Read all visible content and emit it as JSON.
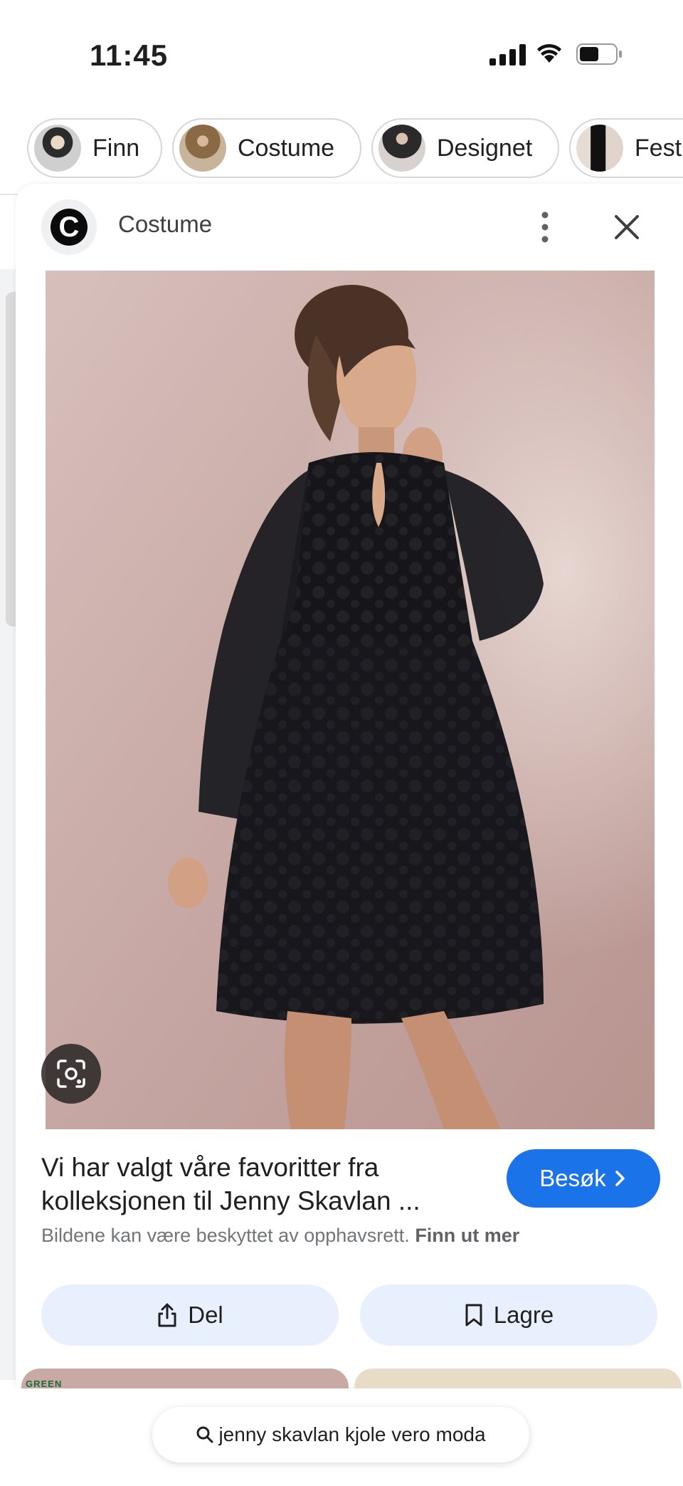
{
  "status_bar": {
    "time": "11:45"
  },
  "chips": [
    {
      "label": "Finn"
    },
    {
      "label": "Costume"
    },
    {
      "label": "Designet"
    },
    {
      "label": "Fest"
    }
  ],
  "card": {
    "source_name": "Costume",
    "source_logo_letter": "C",
    "title": "Vi har valgt våre favoritter fra kolleksjonen til Jenny Skavlan ...",
    "visit_label": "Besøk",
    "copyright_text": "Bildene kan være beskyttet av opphavsrett.",
    "learn_more_label": "Finn ut mer",
    "share_label": "Del",
    "save_label": "Lagre"
  },
  "related": {
    "tag_text": "GREEN"
  },
  "search": {
    "query": "jenny skavlan kjole vero moda"
  },
  "colors": {
    "accent": "#1a73e8",
    "action_bg": "#e8f0fe"
  }
}
